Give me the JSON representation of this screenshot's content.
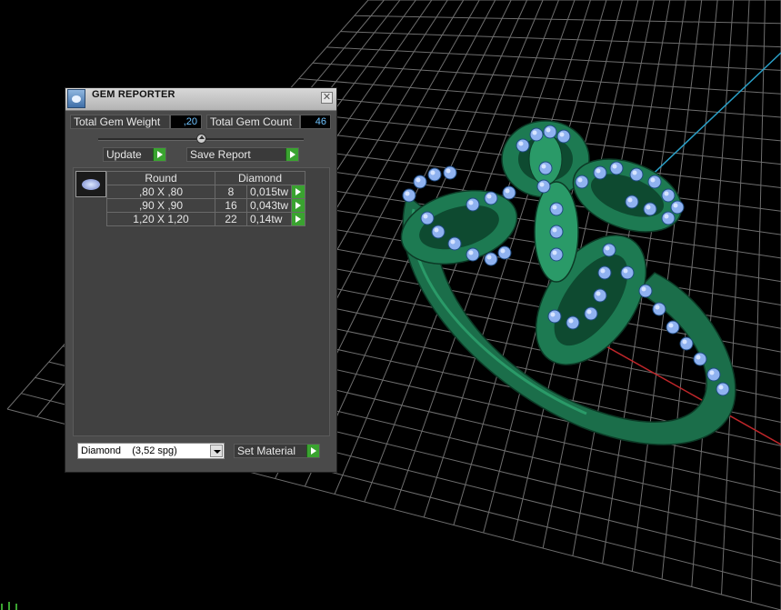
{
  "window": {
    "title": "GEM REPORTER",
    "close_symbol": "✕"
  },
  "totals": {
    "weight_label": "Total Gem Weight",
    "weight_value": ",20",
    "count_label": "Total Gem Count",
    "count_value": "46"
  },
  "buttons": {
    "update": "Update",
    "save_report": "Save Report",
    "set_material": "Set Material"
  },
  "table": {
    "headers": [
      "Round",
      "Diamond"
    ],
    "rows": [
      {
        "size": ",80 X ,80",
        "count": "8",
        "weight": "0,015tw"
      },
      {
        "size": ",90 X ,90",
        "count": "16",
        "weight": "0,043tw"
      },
      {
        "size": "1,20 X 1,20",
        "count": "22",
        "weight": "0,14tw"
      }
    ]
  },
  "material": {
    "selected": "Diamond    (3,52 spg)"
  },
  "colors": {
    "grid": "#6e6e6e",
    "axis_red": "#c0262a",
    "axis_blue": "#2aa0c8",
    "ring_green": "#1d7a52",
    "gem_blue": "#8fb2f0",
    "accent_green": "#3aa330"
  },
  "icons": [
    "gem-reporter-app-icon",
    "close-icon",
    "play-arrow-icon",
    "round-gem-icon",
    "dropdown-arrow-icon"
  ]
}
